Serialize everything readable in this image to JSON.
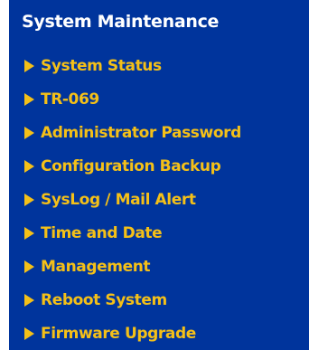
{
  "sidebar": {
    "title": "System Maintenance",
    "arrow_color": "#f4c018",
    "background_color": "#00349c",
    "items": [
      {
        "label": "System Status",
        "icon": "arrow-right-icon"
      },
      {
        "label": "TR-069",
        "icon": "arrow-right-icon"
      },
      {
        "label": "Administrator Password",
        "icon": "arrow-right-icon"
      },
      {
        "label": "Configuration Backup",
        "icon": "arrow-right-icon"
      },
      {
        "label": "SysLog / Mail Alert",
        "icon": "arrow-right-icon"
      },
      {
        "label": "Time and Date",
        "icon": "arrow-right-icon"
      },
      {
        "label": "Management",
        "icon": "arrow-right-icon"
      },
      {
        "label": "Reboot System",
        "icon": "arrow-right-icon"
      },
      {
        "label": "Firmware Upgrade",
        "icon": "arrow-right-icon"
      }
    ]
  }
}
